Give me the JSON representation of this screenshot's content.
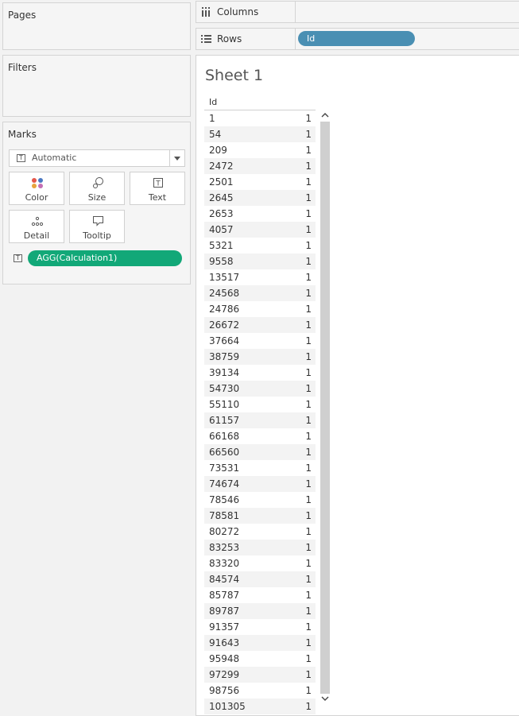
{
  "panels": {
    "pages_title": "Pages",
    "filters_title": "Filters",
    "marks_title": "Marks"
  },
  "marks": {
    "type_value": "Automatic",
    "buttons": [
      "Color",
      "Size",
      "Text",
      "Detail",
      "Tooltip"
    ],
    "field_pill": "AGG(Calculation1)"
  },
  "shelves": {
    "columns_label": "Columns",
    "rows_label": "Rows",
    "rows_pill": "Id"
  },
  "sheet": {
    "title": "Sheet 1",
    "column_header": "Id",
    "rows": [
      {
        "id": "1",
        "value": "1"
      },
      {
        "id": "54",
        "value": "1"
      },
      {
        "id": "209",
        "value": "1"
      },
      {
        "id": "2472",
        "value": "1"
      },
      {
        "id": "2501",
        "value": "1"
      },
      {
        "id": "2645",
        "value": "1"
      },
      {
        "id": "2653",
        "value": "1"
      },
      {
        "id": "4057",
        "value": "1"
      },
      {
        "id": "5321",
        "value": "1"
      },
      {
        "id": "9558",
        "value": "1"
      },
      {
        "id": "13517",
        "value": "1"
      },
      {
        "id": "24568",
        "value": "1"
      },
      {
        "id": "24786",
        "value": "1"
      },
      {
        "id": "26672",
        "value": "1"
      },
      {
        "id": "37664",
        "value": "1"
      },
      {
        "id": "38759",
        "value": "1"
      },
      {
        "id": "39134",
        "value": "1"
      },
      {
        "id": "54730",
        "value": "1"
      },
      {
        "id": "55110",
        "value": "1"
      },
      {
        "id": "61157",
        "value": "1"
      },
      {
        "id": "66168",
        "value": "1"
      },
      {
        "id": "66560",
        "value": "1"
      },
      {
        "id": "73531",
        "value": "1"
      },
      {
        "id": "74674",
        "value": "1"
      },
      {
        "id": "78546",
        "value": "1"
      },
      {
        "id": "78581",
        "value": "1"
      },
      {
        "id": "80272",
        "value": "1"
      },
      {
        "id": "83253",
        "value": "1"
      },
      {
        "id": "83320",
        "value": "1"
      },
      {
        "id": "84574",
        "value": "1"
      },
      {
        "id": "85787",
        "value": "1"
      },
      {
        "id": "89787",
        "value": "1"
      },
      {
        "id": "91357",
        "value": "1"
      },
      {
        "id": "91643",
        "value": "1"
      },
      {
        "id": "95948",
        "value": "1"
      },
      {
        "id": "97299",
        "value": "1"
      },
      {
        "id": "98756",
        "value": "1"
      },
      {
        "id": "101305",
        "value": "1"
      }
    ]
  },
  "colors": {
    "measure_pill": "#12a878",
    "dimension_pill": "#4a8fb3"
  }
}
